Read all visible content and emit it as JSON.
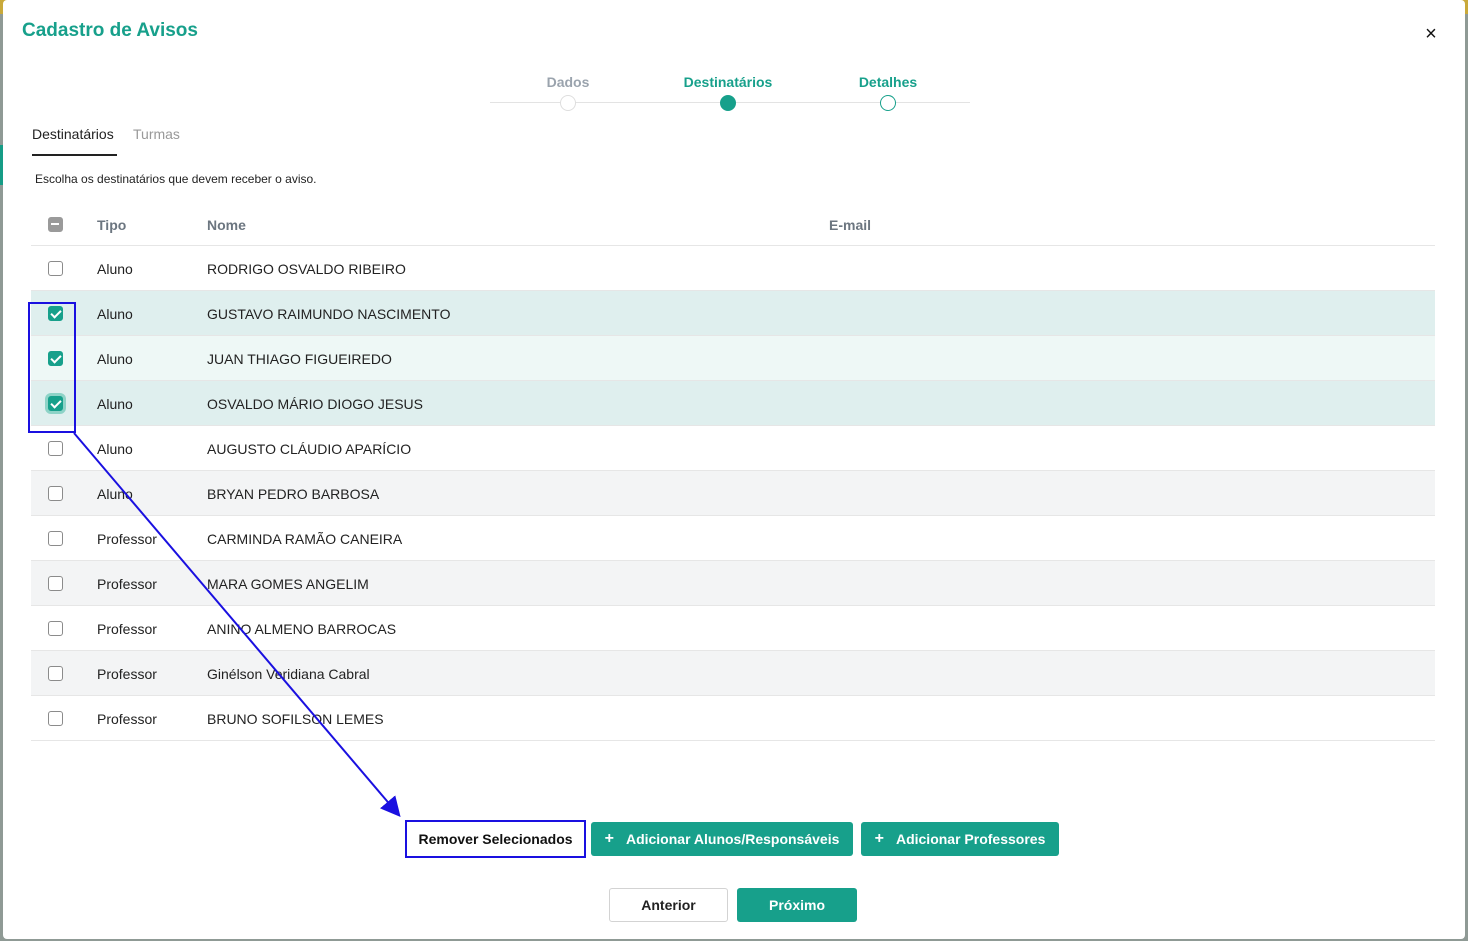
{
  "modal": {
    "title": "Cadastro de Avisos",
    "close_icon": "×"
  },
  "stepper": [
    {
      "label": "Dados",
      "state": "done"
    },
    {
      "label": "Destinatários",
      "state": "active"
    },
    {
      "label": "Detalhes",
      "state": "next"
    }
  ],
  "tabs": [
    {
      "label": "Destinatários",
      "active": true
    },
    {
      "label": "Turmas",
      "active": false
    }
  ],
  "instructions": "Escolha os destinatários que devem receber o aviso.",
  "table": {
    "headers": {
      "tipo": "Tipo",
      "nome": "Nome",
      "email": "E-mail"
    },
    "rows": [
      {
        "tipo": "Aluno",
        "nome": "RODRIGO OSVALDO RIBEIRO",
        "email": "",
        "checked": false
      },
      {
        "tipo": "Aluno",
        "nome": "GUSTAVO RAIMUNDO NASCIMENTO",
        "email": "",
        "checked": true
      },
      {
        "tipo": "Aluno",
        "nome": "JUAN THIAGO FIGUEIREDO",
        "email": "",
        "checked": true
      },
      {
        "tipo": "Aluno",
        "nome": "OSVALDO MÁRIO DIOGO JESUS",
        "email": "",
        "checked": true
      },
      {
        "tipo": "Aluno",
        "nome": "AUGUSTO CLÁUDIO APARÍCIO",
        "email": "",
        "checked": false
      },
      {
        "tipo": "Aluno",
        "nome": "BRYAN PEDRO BARBOSA",
        "email": "",
        "checked": false
      },
      {
        "tipo": "Professor",
        "nome": "CARMINDA RAMÃO CANEIRA",
        "email": "",
        "checked": false
      },
      {
        "tipo": "Professor",
        "nome": "MARA GOMES ANGELIM",
        "email": "",
        "checked": false
      },
      {
        "tipo": "Professor",
        "nome": "ANINO ALMENO BARROCAS",
        "email": "",
        "checked": false
      },
      {
        "tipo": "Professor",
        "nome": "Ginélson Veridiana Cabral",
        "email": "",
        "checked": false
      },
      {
        "tipo": "Professor",
        "nome": "BRUNO SOFILSON LEMES",
        "email": "",
        "checked": false
      }
    ]
  },
  "actions": {
    "remove_label": "Remover Selecionados",
    "add_alunos_label": "Adicionar Alunos/Responsáveis",
    "add_prof_label": "Adicionar Professores",
    "plus_icon": "+"
  },
  "nav": {
    "prev_label": "Anterior",
    "next_label": "Próximo"
  },
  "colors": {
    "accent": "#17a08b",
    "annotation": "#1a10e0"
  }
}
